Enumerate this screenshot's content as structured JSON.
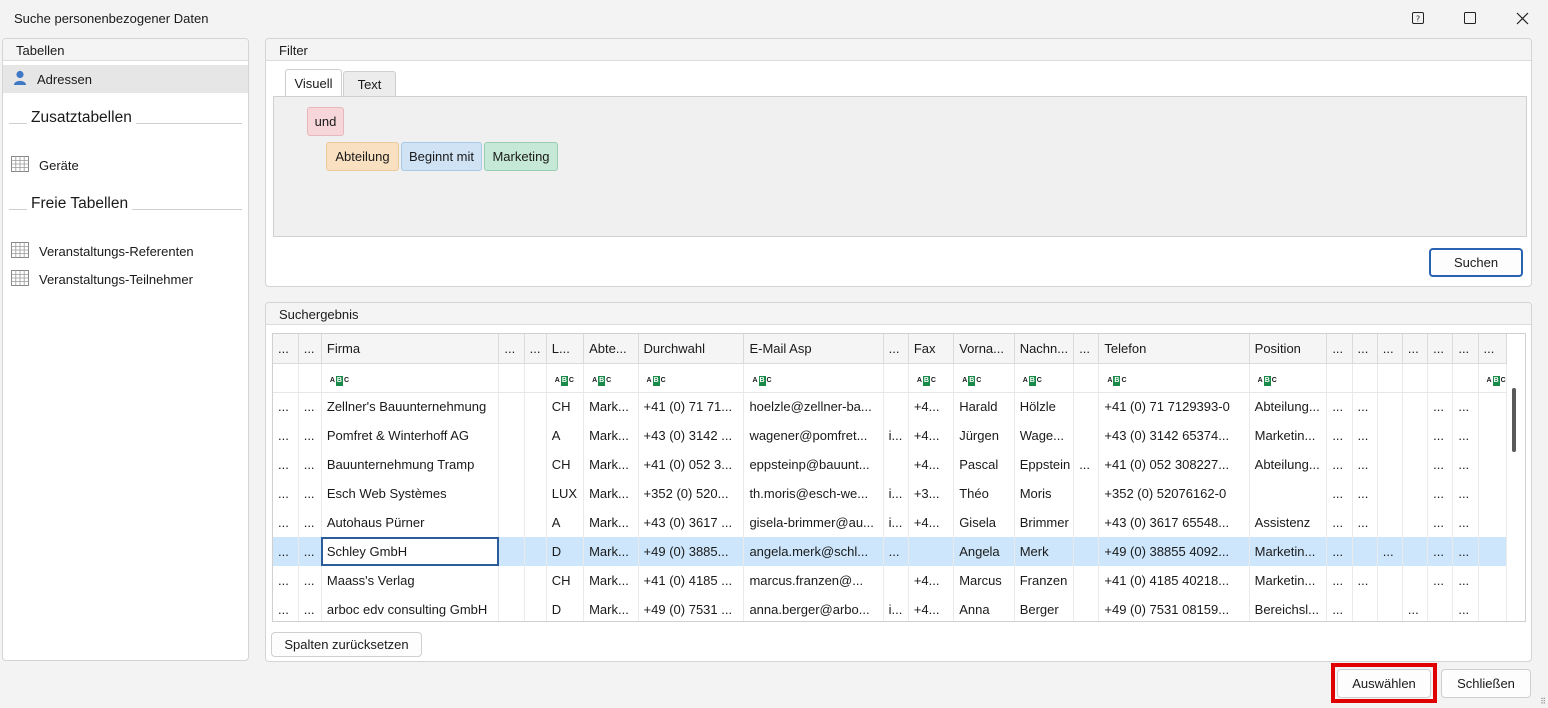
{
  "window": {
    "title": "Suche personenbezogener Daten",
    "help_icon": "help-icon",
    "maximize_icon": "maximize-icon",
    "close_icon": "close-icon"
  },
  "left_panel": {
    "caption": "Tabellen",
    "main_item": {
      "label": "Adressen",
      "icon": "person-icon"
    },
    "group1": {
      "title": "Zusatztabellen",
      "items": [
        {
          "label": "Geräte",
          "icon": "table-icon"
        }
      ]
    },
    "group2": {
      "title": "Freie Tabellen",
      "items": [
        {
          "label": "Veranstaltungs-Referenten",
          "icon": "table-icon"
        },
        {
          "label": "Veranstaltungs-Teilnehmer",
          "icon": "table-icon"
        }
      ]
    }
  },
  "filter": {
    "caption": "Filter",
    "tabs": [
      "Visuell",
      "Text"
    ],
    "active_tab": "Visuell",
    "operator": "und",
    "condition": {
      "field": "Abteilung",
      "operator": "Beginnt mit",
      "value": "Marketing"
    },
    "colors": {
      "operator": "#f6d6d8",
      "field": "#f9e0c0",
      "op": "#cfe3f5",
      "value": "#c6e8d6"
    },
    "search_button": "Suchen"
  },
  "results": {
    "caption": "Suchergebnis",
    "columns": [
      "...",
      "...",
      "Firma",
      "...",
      "...",
      "L...",
      "Abte...",
      "Durchwahl",
      "E-Mail Asp",
      "...",
      "Fax",
      "Vorna...",
      "Nachn...",
      "...",
      "Telefon",
      "Position",
      "...",
      "...",
      "...",
      "...",
      "...",
      "...",
      "..."
    ],
    "rows": [
      [
        "...",
        "...",
        "Zellner's Bauunternehmung",
        "",
        "",
        "CH",
        "Mark...",
        "+41 (0) 71 71...",
        "hoelzle@zellner-ba...",
        "",
        "+4...",
        "Harald",
        "Hölzle",
        "",
        "+41 (0) 71 7129393-0",
        "Abteilung...",
        "...",
        "...",
        "",
        "",
        "...",
        "...",
        ""
      ],
      [
        "...",
        "...",
        "Pomfret & Winterhoff AG",
        "",
        "",
        "A",
        "Mark...",
        "+43 (0) 3142 ...",
        "wagener@pomfret...",
        "i...",
        "+4...",
        "Jürgen",
        "Wage...",
        "",
        "+43 (0) 3142 65374...",
        "Marketin...",
        "...",
        "...",
        "",
        "",
        "...",
        "...",
        ""
      ],
      [
        "...",
        "...",
        "Bauunternehmung Tramp",
        "",
        "",
        "CH",
        "Mark...",
        "+41 (0) 052 3...",
        "eppsteinp@bauunt...",
        "",
        "+4...",
        "Pascal",
        "Eppstein",
        "...",
        "+41 (0) 052 308227...",
        "Abteilung...",
        "...",
        "...",
        "",
        "",
        "...",
        "...",
        ""
      ],
      [
        "...",
        "...",
        "Esch Web Systèmes",
        "",
        "",
        "LUX",
        "Mark...",
        "+352 (0) 520...",
        "th.moris@esch-we...",
        "i...",
        "+3...",
        "Théo",
        "Moris",
        "",
        "+352 (0) 52076162-0",
        "",
        "...",
        "...",
        "",
        "",
        "...",
        "...",
        ""
      ],
      [
        "...",
        "...",
        "Autohaus Pürner",
        "",
        "",
        "A",
        "Mark...",
        "+43 (0) 3617 ...",
        "gisela-brimmer@au...",
        "i...",
        "+4...",
        "Gisela",
        "Brimmer",
        "",
        "+43 (0) 3617 65548...",
        "Assistenz",
        "...",
        "...",
        "",
        "",
        "...",
        "...",
        ""
      ],
      [
        "...",
        "...",
        "Schley GmbH",
        "",
        "",
        "D",
        "Mark...",
        "+49 (0) 3885...",
        "angela.merk@schl...",
        "...",
        "",
        "Angela",
        "Merk",
        "",
        "+49 (0) 38855 4092...",
        "Marketin...",
        "...",
        "",
        "...",
        "",
        "...",
        "...",
        ""
      ],
      [
        "...",
        "...",
        "Maass's Verlag",
        "",
        "",
        "CH",
        "Mark...",
        "+41 (0) 4185 ...",
        "marcus.franzen@...",
        "",
        "+4...",
        "Marcus",
        "Franzen",
        "",
        "+41 (0) 4185 40218...",
        "Marketin...",
        "...",
        "...",
        "",
        "",
        "...",
        "...",
        ""
      ],
      [
        "...",
        "...",
        "arboc edv consulting GmbH",
        "",
        "",
        "D",
        "Mark...",
        "+49 (0) 7531 ...",
        "anna.berger@arbo...",
        "i...",
        "+4...",
        "Anna",
        "Berger",
        "",
        "+49 (0) 7531 08159...",
        "Bereichsl...",
        "...",
        "",
        "",
        "...",
        "",
        "...",
        ""
      ]
    ],
    "selected_row": 5,
    "filter_row_icon": "abc-filter-icon",
    "reset_button": "Spalten zurücksetzen"
  },
  "footer": {
    "select_button": "Auswählen",
    "close_button": "Schließen"
  }
}
